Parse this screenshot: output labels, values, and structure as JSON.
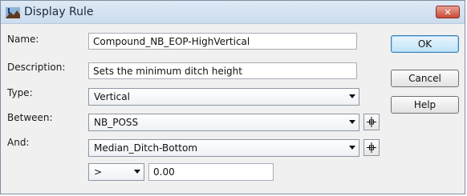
{
  "window": {
    "title": "Display Rule",
    "close_glyph": "✕"
  },
  "form": {
    "name_label": "Name:",
    "name_value": "Compound_NB_EOP-HighVertical",
    "description_label": "Description:",
    "description_value": "Sets the minimum ditch height",
    "type_label": "Type:",
    "type_value": "Vertical",
    "between_label": "Between:",
    "between_value": "NB_POSS",
    "and_label": "And:",
    "and_value": "Median_Ditch-Bottom",
    "operator_value": ">",
    "threshold_value": "0.00"
  },
  "buttons": {
    "ok": "OK",
    "cancel": "Cancel",
    "help": "Help"
  },
  "icons": {
    "title": "map-flag-icon",
    "pick": "crosshair-icon",
    "dropdown": "chevron-down-icon"
  },
  "colors": {
    "close_button": "#c74a36",
    "default_button_border": "#3c7fb1"
  }
}
